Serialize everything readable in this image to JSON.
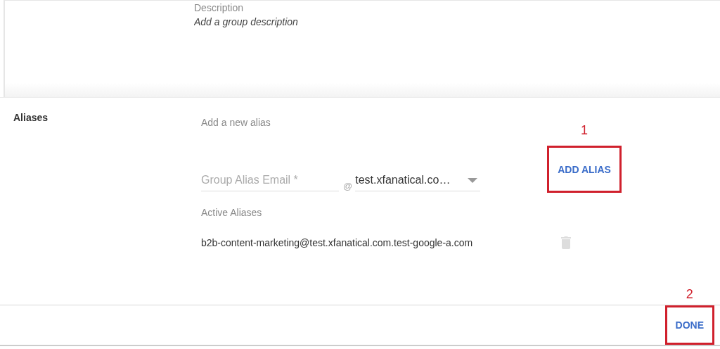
{
  "description": {
    "label": "Description",
    "placeholder": "Add a group description"
  },
  "aliases": {
    "title": "Aliases",
    "add_label": "Add a new alias",
    "email_field": {
      "placeholder": "Group Alias Email *"
    },
    "at_sign": "@",
    "domain_select": {
      "value": "test.xfanatical.co…"
    },
    "add_button": {
      "label": "ADD ALIAS",
      "callout": "1"
    },
    "active_label": "Active Aliases",
    "active": [
      {
        "address": "b2b-content-marketing@test.xfanatical.com.test-google-a.com"
      }
    ]
  },
  "footer": {
    "done_button": {
      "label": "DONE",
      "callout": "2"
    }
  }
}
